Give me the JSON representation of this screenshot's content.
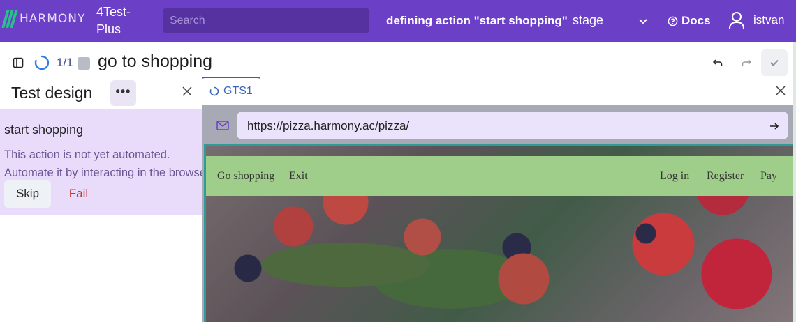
{
  "header": {
    "logo_text": "HARMONY",
    "project_name": "4Test-Plus",
    "search_placeholder": "Search",
    "status": "defining action \"start shopping\"",
    "environment": "stage",
    "docs_label": "Docs",
    "username": "istvan",
    "brand_color": "#6c3fc7"
  },
  "toolbar": {
    "counter": "1/1",
    "test_title": "go to shopping"
  },
  "left_panel": {
    "title": "Test design",
    "more_label": "•••",
    "action_name": "start shopping",
    "message_line1": "This action is not yet automated.",
    "message_line2": "Automate it by interacting in the browser.",
    "skip_label": "Skip",
    "fail_label": "Fail"
  },
  "browser": {
    "tab_label": "GTS1",
    "url": "https://pizza.harmony.ac/pizza/",
    "site_nav": {
      "go_shopping": "Go shopping",
      "exit": "Exit",
      "log_in": "Log in",
      "register": "Register",
      "pay": "Pay"
    }
  },
  "icons": {
    "panel": "sidebar-toggle-icon",
    "spinner": "loading-spinner-icon",
    "stop": "stop-icon",
    "undo": "undo-icon",
    "redo": "redo-icon",
    "confirm": "check-icon",
    "close": "close-icon",
    "mail": "mail-icon",
    "go": "arrow-right-icon",
    "help": "help-circle-icon",
    "user": "user-icon",
    "chevron": "chevron-down-icon"
  }
}
